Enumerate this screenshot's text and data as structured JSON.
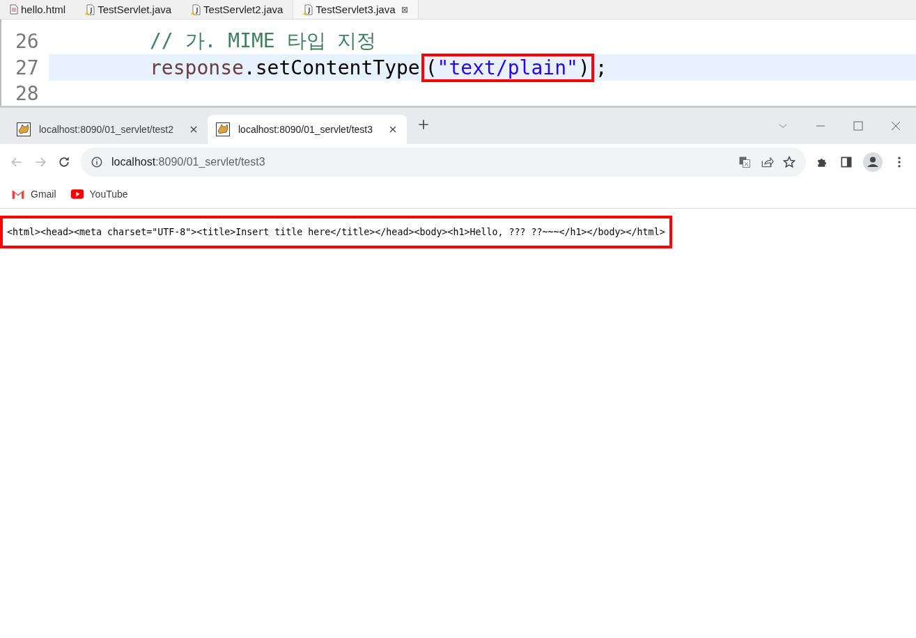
{
  "editor": {
    "tabs": [
      {
        "label": "hello.html",
        "kind": "html",
        "selected": false
      },
      {
        "label": "TestServlet.java",
        "kind": "java",
        "selected": false
      },
      {
        "label": "TestServlet2.java",
        "kind": "java",
        "selected": false
      },
      {
        "label": "TestServlet3.java",
        "kind": "java",
        "selected": true,
        "close": "⊠"
      }
    ],
    "lines": [
      {
        "number": "26",
        "current": false,
        "tokens": [
          {
            "text": "// 가. MIME 타입 지정",
            "kind": "comment",
            "boxed": false
          }
        ]
      },
      {
        "number": "27",
        "current": true,
        "tokens": [
          {
            "text": "response",
            "kind": "variable",
            "boxed": false
          },
          {
            "text": ".setContentType",
            "kind": "plain",
            "boxed": false
          },
          {
            "text": "(",
            "kind": "plain",
            "boxed": true
          },
          {
            "text": "\"text/plain\"",
            "kind": "string",
            "boxed": true
          },
          {
            "text": ")",
            "kind": "plain",
            "boxed": true
          },
          {
            "text": ";",
            "kind": "plain",
            "boxed": false
          }
        ]
      },
      {
        "number": "28",
        "current": false
      }
    ]
  },
  "browser": {
    "tabs": [
      {
        "title": "localhost:8090/01_servlet/test2",
        "selected": false
      },
      {
        "title": "localhost:8090/01_servlet/test3",
        "selected": true
      }
    ],
    "address": {
      "host": "localhost",
      "rest": ":8090/01_servlet/test3"
    },
    "bookmarks": [
      {
        "label": "Gmail",
        "kind": "gmail"
      },
      {
        "label": "YouTube",
        "kind": "youtube"
      }
    ],
    "page_text": {
      "text": "<html><head><meta charset=\"UTF-8\"><title>Insert title here</title></head><body><h1>Hello, ??? ??~~~</h1></body></html>",
      "boxed": true
    }
  }
}
